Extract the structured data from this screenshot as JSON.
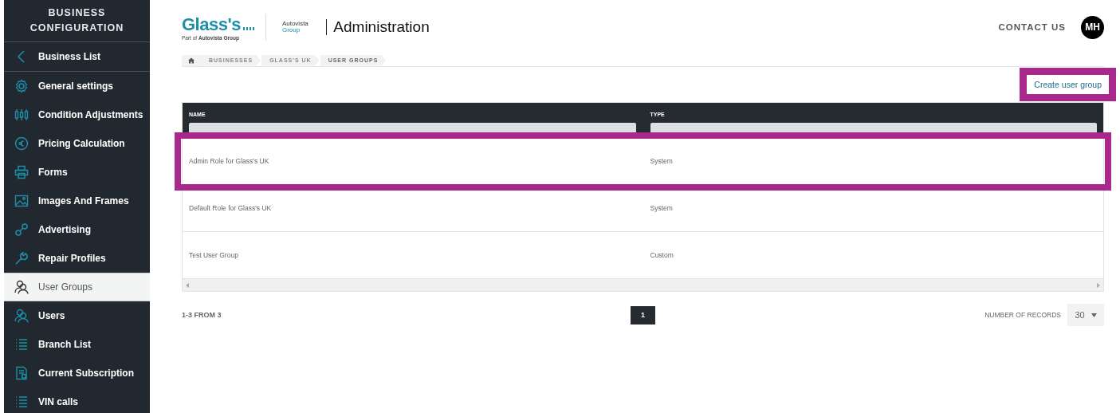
{
  "sidebar": {
    "title": "BUSINESS CONFIGURATION",
    "back": {
      "label": "Business List"
    },
    "items": [
      {
        "label": "General settings",
        "selected": false
      },
      {
        "label": "Condition Adjustments",
        "selected": false
      },
      {
        "label": "Pricing Calculation",
        "selected": false
      },
      {
        "label": "Forms",
        "selected": false
      },
      {
        "label": "Images And Frames",
        "selected": false
      },
      {
        "label": "Advertising",
        "selected": false
      },
      {
        "label": "Repair Profiles",
        "selected": false
      },
      {
        "label": "User Groups",
        "selected": true
      },
      {
        "label": "Users",
        "selected": false
      },
      {
        "label": "Branch List",
        "selected": false
      },
      {
        "label": "Current Subscription",
        "selected": false
      },
      {
        "label": "VIN calls",
        "selected": false
      }
    ]
  },
  "header": {
    "logo": {
      "name": "Glass's",
      "tagline_prefix": "Part of ",
      "tagline_brand": "Autovista Group"
    },
    "partner": {
      "line1": "Autovista",
      "line2": "Group"
    },
    "title": "Administration",
    "contact": "CONTACT US",
    "avatar": "MH"
  },
  "breadcrumb": [
    "BUSINESSES",
    "GLASS'S UK",
    "USER GROUPS"
  ],
  "create_button": {
    "label": "Create user group",
    "highlighted": true
  },
  "table": {
    "columns": [
      "NAME",
      "TYPE"
    ],
    "rows": [
      {
        "name": "Admin Role for Glass's UK",
        "type": "System",
        "highlighted": true
      },
      {
        "name": "Default Role for Glass's UK",
        "type": "System",
        "highlighted": false
      },
      {
        "name": "Test User Group",
        "type": "Custom",
        "highlighted": false
      }
    ]
  },
  "footer": {
    "range": "1-3 FROM 3",
    "pages": [
      {
        "label": "1",
        "selected": true
      }
    ],
    "records_label": "NUMBER OF RECORDS",
    "records_value": "30"
  }
}
